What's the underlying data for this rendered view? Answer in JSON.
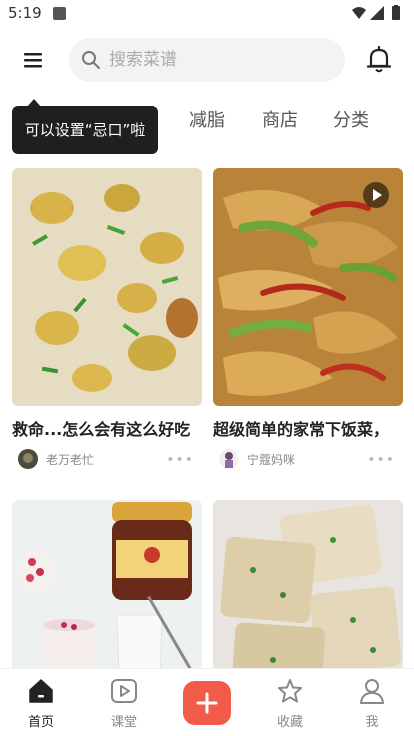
{
  "status_bar": {
    "time": "5:19"
  },
  "search": {
    "placeholder": "搜索菜谱"
  },
  "tabs": [
    {
      "label": "减脂"
    },
    {
      "label": "商店"
    },
    {
      "label": "分类"
    }
  ],
  "tooltip": {
    "text": "可以设置“忌口”啦"
  },
  "cards": [
    {
      "title": "救命...怎么会有这么好吃",
      "author": "老万老忙",
      "more": "•••",
      "has_video": false
    },
    {
      "title": "超级简单的家常下饭菜，",
      "author": "宁蔻妈咪",
      "more": "•••",
      "has_video": true
    },
    {
      "title": "",
      "author": "",
      "more": "",
      "has_video": false
    },
    {
      "title": "",
      "author": "",
      "more": "",
      "has_video": false
    }
  ],
  "bottom_nav": [
    {
      "label": "首页",
      "icon": "home-icon",
      "active": true
    },
    {
      "label": "课堂",
      "icon": "play-icon",
      "active": false
    },
    {
      "label": "",
      "icon": "plus-icon",
      "active": false
    },
    {
      "label": "收藏",
      "icon": "star-icon",
      "active": false
    },
    {
      "label": "我",
      "icon": "user-icon",
      "active": false
    }
  ],
  "colors": {
    "accent": "#f25a4a",
    "tooltip_bg": "#1f1f1f",
    "search_bg": "#f3f3f3"
  }
}
